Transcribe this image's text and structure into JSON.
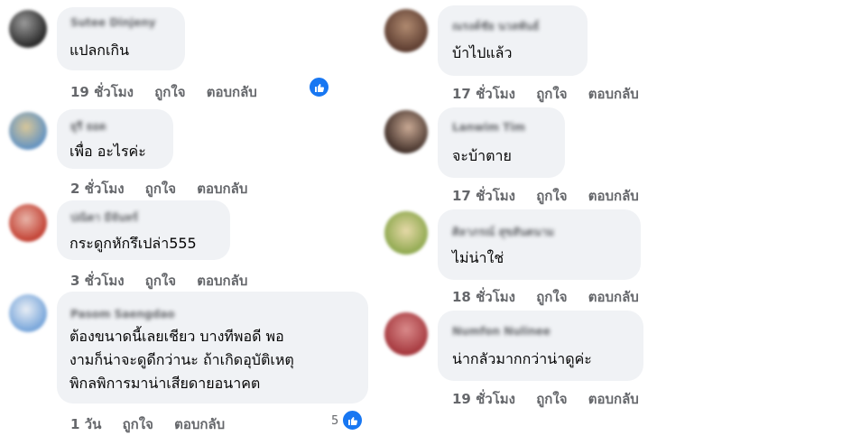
{
  "left": [
    {
      "author": "Sutee Dinjeny",
      "lines": [
        "แปลกเกิน"
      ],
      "time": "19 ชั่วโมง",
      "like": "ถูกใจ",
      "reply": "ตอบกลับ",
      "reaction_count": "",
      "avatar_colors": [
        "#2a2a2a",
        "#8e8e8e"
      ]
    },
    {
      "author": "ยุรี ยอด",
      "lines": [
        "เพื่อ อะไรค่ะ"
      ],
      "time": "2 ชั่วโมง",
      "like": "ถูกใจ",
      "reply": "ตอบกลับ",
      "reaction_count": "",
      "avatar_colors": [
        "#5b8fc4",
        "#d8c79a"
      ]
    },
    {
      "author": "ปณิตา มีจันทร์",
      "lines": [
        "กระดูกหักรึเปล่า555"
      ],
      "time": "3 ชั่วโมง",
      "like": "ถูกใจ",
      "reply": "ตอบกลับ",
      "reaction_count": "",
      "avatar_colors": [
        "#c0392b",
        "#e8b4a8"
      ]
    },
    {
      "author": "Pasom Saengdao",
      "lines": [
        "ต้องขนาดนี้เลยเชียว บางทีพอดี พอ",
        "งามก็น่าจะดูดีกว่านะ ถ้าเกิดอุบัติเหตุ",
        "พิกลพิการมาน่าเสียดายอนาคต"
      ],
      "time": "1 วัน",
      "like": "ถูกใจ",
      "reply": "ตอบกลับ",
      "reaction_count": "5",
      "avatar_colors": [
        "#6fa0d8",
        "#e9eef5"
      ]
    }
  ],
  "right": [
    {
      "author": "ณรงค์ชัย นวลพันธ์",
      "lines": [
        "บ้าไปแล้ว"
      ],
      "time": "17 ชั่วโมง",
      "like": "ถูกใจ",
      "reply": "ตอบกลับ",
      "avatar_colors": [
        "#5a3a2e",
        "#b08a70"
      ]
    },
    {
      "author": "Lanwim Tim",
      "lines": [
        "จะบ้าตาย"
      ],
      "time": "17 ชั่วโมง",
      "like": "ถูกใจ",
      "reply": "ตอบกลับ",
      "avatar_colors": [
        "#3b2a24",
        "#c9a994"
      ]
    },
    {
      "author": "ศิลาภรณ์ สุขสันตนาม",
      "lines": [
        "ไม่น่าใช่"
      ],
      "time": "18 ชั่วโมง",
      "like": "ถูกใจ",
      "reply": "ตอบกลับ",
      "avatar_colors": [
        "#8aa64a",
        "#e6d9a8"
      ]
    },
    {
      "author": "Numfon Nulinee",
      "lines": [
        "น่ากลัวมากกว่าน่าดูค่ะ"
      ],
      "time": "19 ชั่วโมง",
      "like": "ถูกใจ",
      "reply": "ตอบกลับ",
      "avatar_colors": [
        "#a3343a",
        "#d98a8a"
      ]
    }
  ],
  "icons": {
    "like_reaction": "thumbs-up-icon",
    "color_like_blue": "#1877f2"
  }
}
